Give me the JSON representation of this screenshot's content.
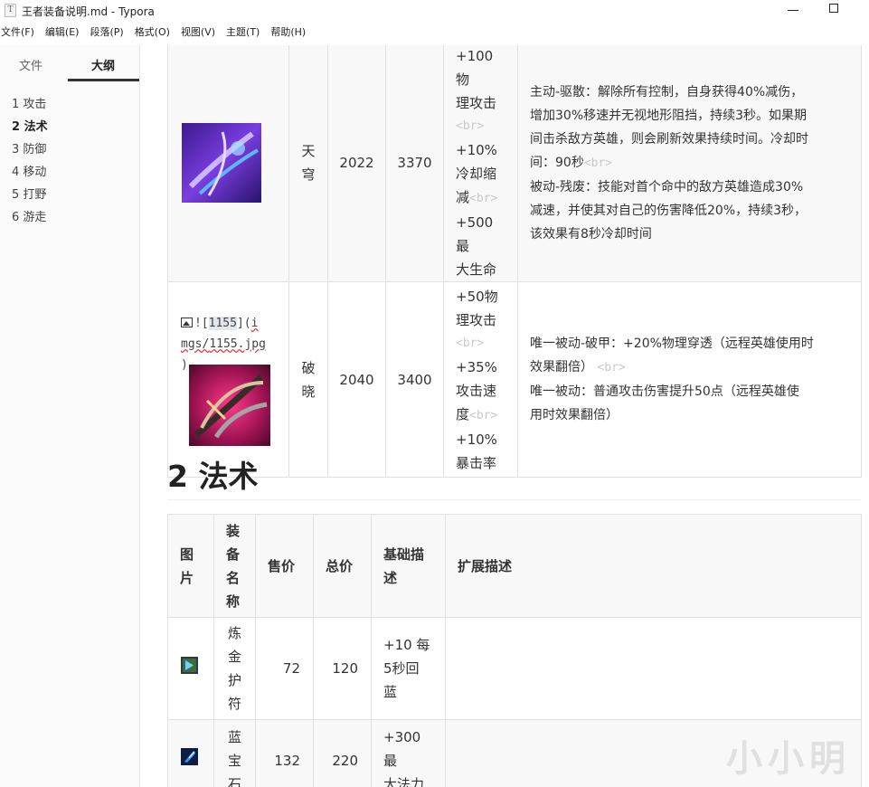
{
  "window": {
    "app_icon": "T",
    "title": "王者装备说明.md - Typora",
    "minimize_icon": "minimize-icon",
    "maximize_icon": "maximize-icon"
  },
  "menu": [
    "文件(F)",
    "编辑(E)",
    "段落(P)",
    "格式(O)",
    "视图(V)",
    "主题(T)",
    "帮助(H)"
  ],
  "sidebar": {
    "tabs": [
      "文件",
      "大纲"
    ],
    "active_tab": "大纲",
    "outline": [
      "1 攻击",
      "2 法术",
      "3 防御",
      "4 移动",
      "5 打野",
      "6 游走"
    ],
    "active_outline": "2 法术"
  },
  "table1": {
    "rows": [
      {
        "name": [
          "天",
          "穹"
        ],
        "sell": "2022",
        "total": "3370",
        "base": [
          "+100物",
          "理攻击",
          "<br>",
          "+10%",
          "冷却缩",
          "减<br>",
          "+500最",
          "大生命"
        ],
        "ext": [
          "主动-驱散：解除所有控制，自身获得40%减伤，",
          "增加30%移速并无视地形阻挡，持续3秒。如果期",
          "间击杀敌方英雄，则会刷新效果持续时间。冷却时",
          "间：90秒",
          "<br>",
          "被动-残废：技能对首个命中的敌方英雄造成30%",
          "减速，并使其对自己的伤害降低20%，持续3秒，",
          "该效果有8秒冷却时间"
        ]
      },
      {
        "img_src": [
          "![",
          "1155",
          "](",
          "i",
          "mgs/",
          "1155.jpg",
          ")"
        ],
        "name": [
          "破",
          "晓"
        ],
        "sell": "2040",
        "total": "3400",
        "base": [
          "+50物",
          "理攻击",
          "<br>",
          "+35%",
          "攻击速",
          "度<br>",
          "+10%",
          "暴击率"
        ],
        "ext": [
          "唯一被动-破甲：+20%物理穿透（远程英雄使用时",
          "效果翻倍）",
          "<br>",
          "唯一被动：普通攻击伤害提升50点（远程英雄使",
          "用时效果翻倍）"
        ]
      }
    ]
  },
  "section2": {
    "heading": "2 法术"
  },
  "table2": {
    "headers": {
      "img": [
        "图",
        "片"
      ],
      "name": [
        "装",
        "备",
        "名",
        "称"
      ],
      "sell": "售价",
      "total": "总价",
      "base": [
        "基础描",
        "述"
      ],
      "ext": "扩展描述"
    },
    "rows": [
      {
        "name": [
          "炼",
          "金",
          "护",
          "符"
        ],
        "sell": "72",
        "total": "120",
        "base": [
          "+10 每",
          "5秒回",
          "蓝"
        ],
        "ext": ""
      },
      {
        "name": [
          "蓝",
          "宝",
          "石"
        ],
        "sell": "132",
        "total": "220",
        "base": [
          "+300最",
          "大法力"
        ],
        "ext": ""
      }
    ]
  },
  "watermark": "小小明",
  "colors": {
    "accent": "#333333",
    "border": "#dfe2e5",
    "br_tag": "#c9c9c9",
    "underline_error": "#e04040"
  }
}
